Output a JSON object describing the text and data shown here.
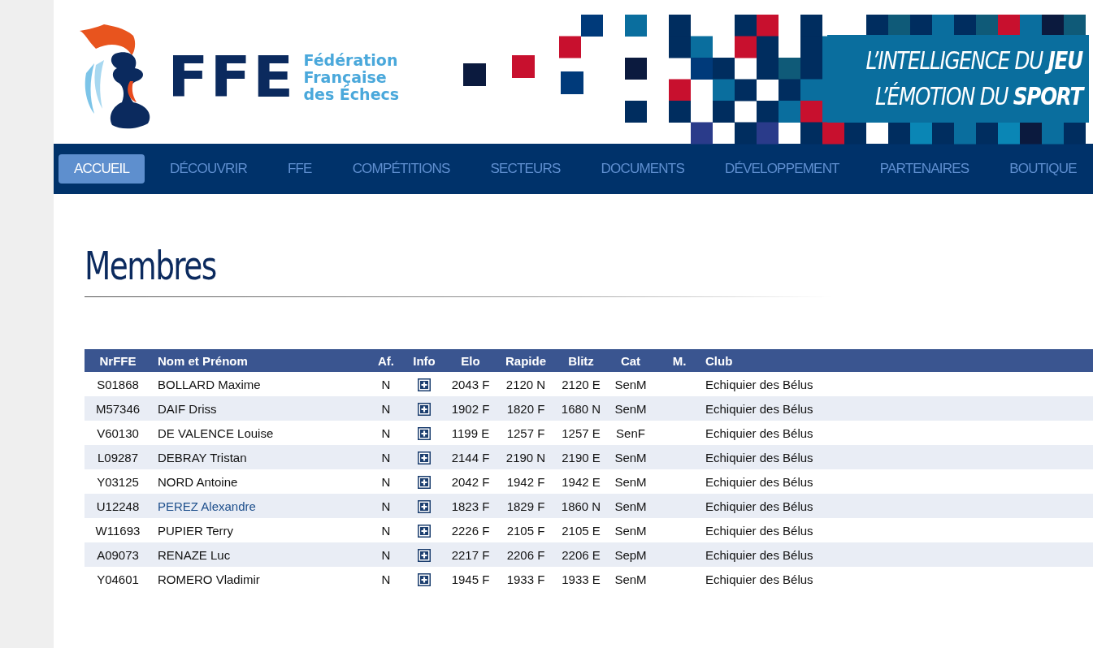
{
  "header": {
    "logo_text": "FFE",
    "logo_subtitle": [
      "Fédération",
      "Française",
      "des Échecs"
    ],
    "tagline": [
      "L’INTELLIGENCE DU **JEU**",
      "L’ÉMOTION DU **SPORT**"
    ]
  },
  "nav": [
    {
      "label": "ACCUEIL",
      "selected": true
    },
    {
      "label": "DÉCOUVRIR",
      "selected": false
    },
    {
      "label": "FFE",
      "selected": false
    },
    {
      "label": "COMPÉTITIONS",
      "selected": false
    },
    {
      "label": "SECTEURS",
      "selected": false
    },
    {
      "label": "DOCUMENTS",
      "selected": false
    },
    {
      "label": "DÉVELOPPEMENT",
      "selected": false
    },
    {
      "label": "PARTENAIRES",
      "selected": false
    },
    {
      "label": "BOUTIQUE",
      "selected": false
    }
  ],
  "page_title": "Membres",
  "table": {
    "columns": [
      "NrFFE",
      "Nom et Prénom",
      "Af.",
      "Info",
      "Elo",
      "Rapide",
      "Blitz",
      "Cat",
      "M.",
      "Club"
    ],
    "rows": [
      {
        "nr": "S01868",
        "name": "BOLLARD Maxime",
        "af": "N",
        "elo": "2043 F",
        "rapide": "2120 N",
        "blitz": "2120 E",
        "cat": "SenM",
        "club": "Echiquier des Bélus",
        "hovered": false
      },
      {
        "nr": "M57346",
        "name": "DAIF Driss",
        "af": "N",
        "elo": "1902 F",
        "rapide": "1820 F",
        "blitz": "1680 N",
        "cat": "SenM",
        "club": "Echiquier des Bélus",
        "hovered": false
      },
      {
        "nr": "V60130",
        "name": "DE VALENCE Louise",
        "af": "N",
        "elo": "1199 E",
        "rapide": "1257 F",
        "blitz": "1257 E",
        "cat": "SenF",
        "club": "Echiquier des Bélus",
        "hovered": false
      },
      {
        "nr": "L09287",
        "name": "DEBRAY Tristan",
        "af": "N",
        "elo": "2144 F",
        "rapide": "2190 N",
        "blitz": "2190 E",
        "cat": "SenM",
        "club": "Echiquier des Bélus",
        "hovered": false
      },
      {
        "nr": "Y03125",
        "name": "NORD Antoine",
        "af": "N",
        "elo": "2042 F",
        "rapide": "1942 F",
        "blitz": "1942 E",
        "cat": "SenM",
        "club": "Echiquier des Bélus",
        "hovered": false
      },
      {
        "nr": "U12248",
        "name": "PEREZ Alexandre",
        "af": "N",
        "elo": "1823 F",
        "rapide": "1829 F",
        "blitz": "1860 N",
        "cat": "SenM",
        "club": "Echiquier des Bélus",
        "hovered": true
      },
      {
        "nr": "W11693",
        "name": "PUPIER Terry",
        "af": "N",
        "elo": "2226 F",
        "rapide": "2105 F",
        "blitz": "2105 E",
        "cat": "SenM",
        "club": "Echiquier des Bélus",
        "hovered": false
      },
      {
        "nr": "A09073",
        "name": "RENAZE Luc",
        "af": "N",
        "elo": "2217 F",
        "rapide": "2206 F",
        "blitz": "2206 E",
        "cat": "SepM",
        "club": "Echiquier des Bélus",
        "hovered": false
      },
      {
        "nr": "Y04601",
        "name": "ROMERO Vladimir",
        "af": "N",
        "elo": "1945 F",
        "rapide": "1933 F",
        "blitz": "1933 E",
        "cat": "SenM",
        "club": "Echiquier des Bélus",
        "hovered": false
      }
    ]
  }
}
